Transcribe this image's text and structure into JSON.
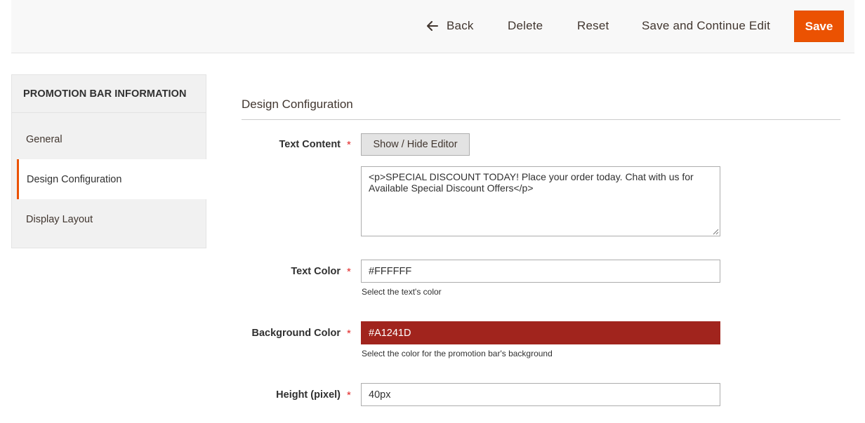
{
  "toolbar": {
    "back_label": "Back",
    "delete_label": "Delete",
    "reset_label": "Reset",
    "save_continue_label": "Save and Continue Edit",
    "save_label": "Save",
    "back_icon": "arrow-left-icon",
    "accent_color": "#eb5202"
  },
  "sidebar": {
    "title": "PROMOTION BAR INFORMATION",
    "items": [
      {
        "label": "General",
        "active": false
      },
      {
        "label": "Design Configuration",
        "active": true
      },
      {
        "label": "Display Layout",
        "active": false
      }
    ]
  },
  "section": {
    "title": "Design Configuration"
  },
  "form": {
    "text_content": {
      "label": "Text Content",
      "editor_button": "Show / Hide Editor",
      "value": "<p>SPECIAL DISCOUNT TODAY! Place your order today. Chat with us for Available Special Discount Offers</p>"
    },
    "text_color": {
      "label": "Text Color",
      "value": "#FFFFFF",
      "note": "Select the text's color"
    },
    "background_color": {
      "label": "Background Color",
      "value": "#A1241D",
      "note": "Select the color for the promotion bar's background",
      "swatch": "#a1241d"
    },
    "height": {
      "label": "Height (pixel)",
      "value": "40px"
    },
    "required_mark": "*"
  }
}
